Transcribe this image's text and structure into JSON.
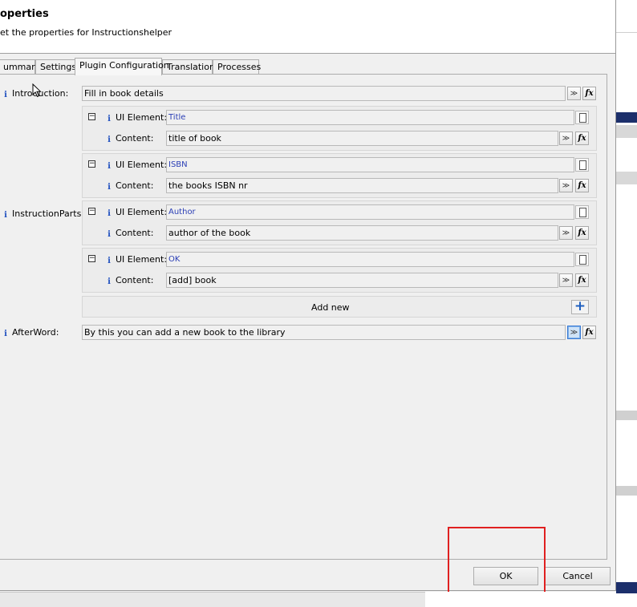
{
  "header": {
    "title": "operties",
    "subtitle": "et the properties for Instructionshelper"
  },
  "tabs": [
    "ummary",
    "Settings",
    "Plugin Configuration",
    "Translation",
    "Processes"
  ],
  "active_tab": "Plugin Configuration",
  "introduction": {
    "label": "Introduction:",
    "value": "Fill in book details"
  },
  "instruction_parts": {
    "label": "InstructionParts:",
    "ui_element_label": "UI Element:",
    "content_label": "Content:",
    "items": [
      {
        "ui_element": "Title",
        "content": "title of book"
      },
      {
        "ui_element": "ISBN",
        "content": "the books ISBN nr"
      },
      {
        "ui_element": "Author",
        "content": "author of the book"
      },
      {
        "ui_element": "OK",
        "content": "[add] book"
      }
    ],
    "add_new_label": "Add new",
    "add_icon": "+"
  },
  "afterword": {
    "label": "AfterWord:",
    "value": "By this you can add a new book to the library"
  },
  "glyphs": {
    "info": "i",
    "fx": "fx",
    "chevron": "≫",
    "collapse": "−"
  },
  "buttons": {
    "ok": "OK",
    "cancel": "Cancel"
  },
  "colors": {
    "accent_blue": "#1f4fbf",
    "highlight_red": "#e02020",
    "dark_navy": "#1c2f6b"
  }
}
